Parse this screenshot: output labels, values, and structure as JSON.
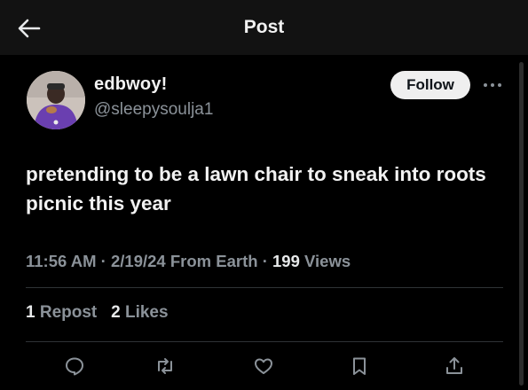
{
  "header": {
    "title": "Post",
    "back_icon": "arrow-left-icon"
  },
  "post": {
    "display_name": "edbwoy!",
    "handle": "@sleepysoulja1",
    "follow_label": "Follow",
    "more_icon": "more-horizontal-icon",
    "text": "pretending to be a lawn chair to sneak into roots picnic this year",
    "time": "11:56 AM",
    "date": "2/19/24",
    "location": "From Earth",
    "views_count": "199",
    "views_label": "Views",
    "separator": "·",
    "reposts_count": "1",
    "reposts_label": "Repost",
    "likes_count": "2",
    "likes_label": "Likes"
  },
  "actions": [
    "reply-icon",
    "repost-icon",
    "like-icon",
    "bookmark-icon",
    "share-icon"
  ],
  "colors": {
    "background": "#000000",
    "topbar": "#121212",
    "text": "#e7e9ea",
    "muted": "#8b9299",
    "divider": "#2f3336",
    "follow_bg": "#efefef"
  }
}
